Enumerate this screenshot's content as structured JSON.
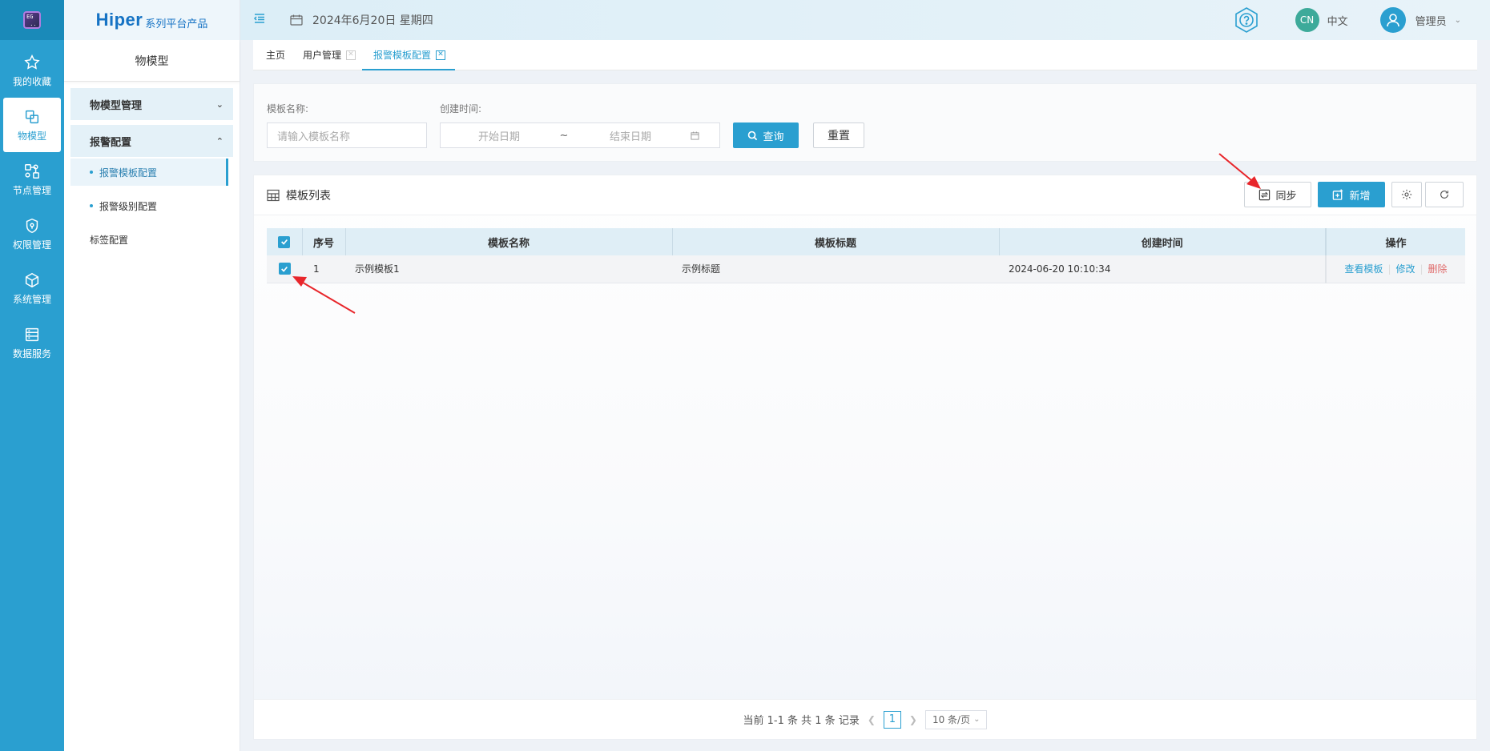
{
  "rail": {
    "items": [
      {
        "label": "我的收藏"
      },
      {
        "label": "物模型"
      },
      {
        "label": "节点管理"
      },
      {
        "label": "权限管理"
      },
      {
        "label": "系统管理"
      },
      {
        "label": "数据服务"
      }
    ]
  },
  "brand": {
    "name": "Hiper",
    "suffix": "系列平台产品"
  },
  "submenu": {
    "title": "物模型",
    "groups": [
      {
        "label": "物模型管理"
      },
      {
        "label": "报警配置"
      }
    ],
    "items": [
      {
        "label": "报警模板配置"
      },
      {
        "label": "报警级别配置"
      }
    ],
    "plain": {
      "label": "标签配置"
    }
  },
  "header": {
    "date": "2024年6月20日 星期四",
    "lang_badge": "CN",
    "lang_label": "中文",
    "user": "管理员"
  },
  "tabs": [
    {
      "label": "主页"
    },
    {
      "label": "用户管理"
    },
    {
      "label": "报警模板配置"
    }
  ],
  "search": {
    "name_label": "模板名称:",
    "name_placeholder": "请输入模板名称",
    "time_label": "创建时间:",
    "start_placeholder": "开始日期",
    "range_sep": "~",
    "end_placeholder": "结束日期",
    "query_label": "查询",
    "reset_label": "重置"
  },
  "list": {
    "title": "模板列表",
    "sync_label": "同步",
    "add_label": "新增",
    "columns": [
      "序号",
      "模板名称",
      "模板标题",
      "创建时间",
      "操作"
    ],
    "rows": [
      {
        "index": "1",
        "name": "示例模板1",
        "title": "示例标题",
        "created": "2024-06-20 10:10:34",
        "view": "查看模板",
        "edit": "修改",
        "delete": "删除"
      }
    ],
    "pager": {
      "summary": "当前 1-1 条 共 1 条 记录",
      "current_page": "1",
      "page_size": "10 条/页"
    }
  },
  "colors": {
    "accent": "#2a9fd0",
    "danger": "#e06b6b",
    "annotation": "#e8262b"
  }
}
